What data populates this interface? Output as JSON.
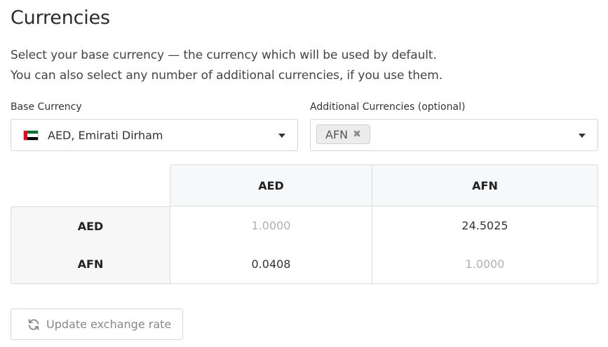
{
  "page": {
    "title": "Currencies",
    "description_line1": "Select your base currency — the currency which will be used by default.",
    "description_line2": "You can also select any number of additional currencies, if you use them."
  },
  "base_currency": {
    "label": "Base Currency",
    "selected": "AED, Emirati Dirham",
    "flag_icon": "uae-flag-icon",
    "flag_colors": [
      "#ce1126",
      "#00732f",
      "#ffffff",
      "#000000"
    ]
  },
  "additional_currencies": {
    "label": "Additional Currencies (optional)",
    "tags": [
      {
        "code": "AFN",
        "remove_symbol": "✖"
      }
    ]
  },
  "exchange_matrix": {
    "columns": [
      "AED",
      "AFN"
    ],
    "rows": [
      {
        "label": "AED",
        "values": [
          "1.0000",
          "24.5025"
        ]
      },
      {
        "label": "AFN",
        "values": [
          "0.0408",
          "1.0000"
        ]
      }
    ]
  },
  "actions": {
    "update_label": "Update exchange rate",
    "update_icon": "refresh-icon"
  }
}
